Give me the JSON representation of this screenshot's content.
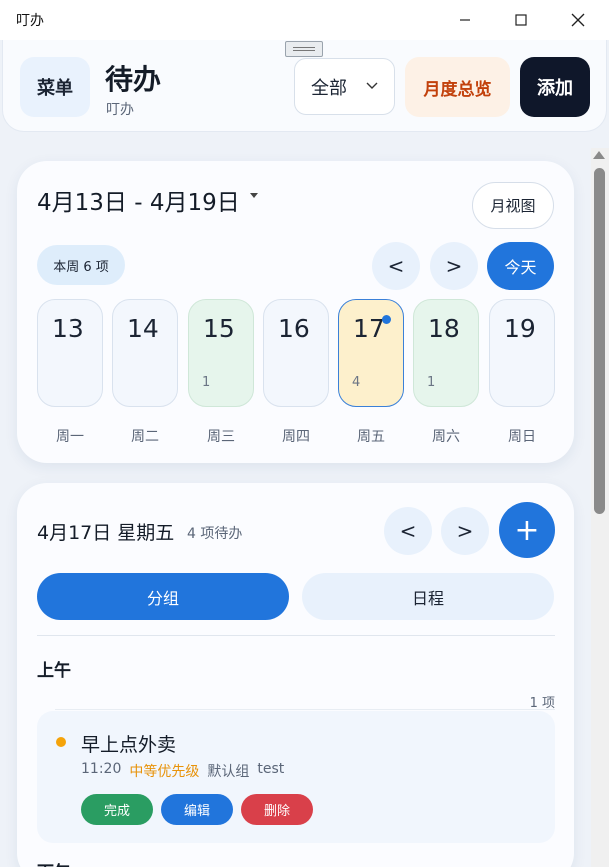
{
  "window": {
    "title": "叮办"
  },
  "header": {
    "menu_label": "菜单",
    "title": "待办",
    "subtitle": "叮办",
    "filter_value": "全部",
    "overview_label": "月度总览",
    "add_label": "添加"
  },
  "week": {
    "range": "4月13日 - 4月19日",
    "month_view_label": "月视图",
    "week_count": "本周 6 项",
    "prev_label": "<",
    "next_label": ">",
    "today_label": "今天",
    "days": [
      {
        "num": "13",
        "count": "",
        "weekday": "周一",
        "state": "normal"
      },
      {
        "num": "14",
        "count": "",
        "weekday": "周二",
        "state": "normal"
      },
      {
        "num": "15",
        "count": "1",
        "weekday": "周三",
        "state": "has"
      },
      {
        "num": "16",
        "count": "",
        "weekday": "周四",
        "state": "normal"
      },
      {
        "num": "17",
        "count": "4",
        "weekday": "周五",
        "state": "selected"
      },
      {
        "num": "18",
        "count": "1",
        "weekday": "周六",
        "state": "has"
      },
      {
        "num": "19",
        "count": "",
        "weekday": "周日",
        "state": "normal"
      }
    ]
  },
  "day": {
    "title": "4月17日 星期五",
    "pending": "4 项待办",
    "prev_label": "<",
    "next_label": ">",
    "add_label": "+",
    "tabs": [
      {
        "label": "分组",
        "active": true
      },
      {
        "label": "日程",
        "active": false
      }
    ],
    "groups": [
      {
        "title": "上午",
        "count": "1 项",
        "tasks": [
          {
            "title": "早上点外卖",
            "time": "11:20",
            "priority": "中等优先级",
            "group": "默认组",
            "tag": "test",
            "priority_color": "#f5a30a",
            "actions": {
              "done": "完成",
              "edit": "编辑",
              "delete": "删除"
            }
          }
        ]
      },
      {
        "title": "下午"
      }
    ]
  },
  "colors": {
    "accent": "#2175dc",
    "dark_button": "#0f172a",
    "overview_text": "#c2410c",
    "done": "#2a9d62",
    "delete": "#d9404a"
  }
}
